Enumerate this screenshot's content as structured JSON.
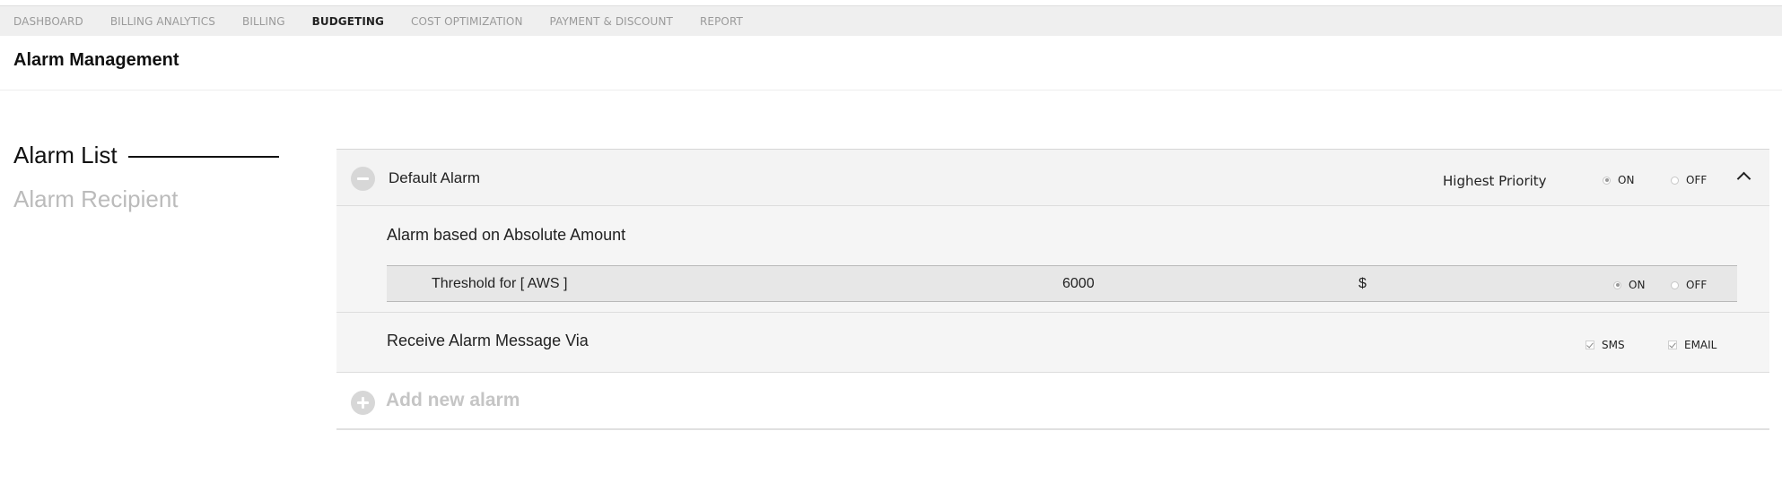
{
  "topnav": {
    "items": [
      {
        "label": "DASHBOARD",
        "active": false
      },
      {
        "label": "BILLING ANALYTICS",
        "active": false
      },
      {
        "label": "BILLING",
        "active": false
      },
      {
        "label": "BUDGETING",
        "active": true
      },
      {
        "label": "COST OPTIMIZATION",
        "active": false
      },
      {
        "label": "PAYMENT & DISCOUNT",
        "active": false
      },
      {
        "label": "REPORT",
        "active": false
      }
    ]
  },
  "page": {
    "title": "Alarm Management"
  },
  "sidenav": {
    "items": [
      {
        "label": "Alarm List",
        "active": true
      },
      {
        "label": "Alarm Recipient",
        "active": false
      }
    ]
  },
  "alarm": {
    "name": "Default Alarm",
    "priority_label": "Highest Priority",
    "priority_on": "ON",
    "priority_off": "OFF",
    "priority_selected": "ON",
    "section_title": "Alarm based on Absolute Amount",
    "threshold_label": "Threshold for [ AWS ]",
    "threshold_value": "6000",
    "currency": "$",
    "threshold_on": "ON",
    "threshold_off": "OFF",
    "threshold_selected": "ON",
    "receive_title": "Receive Alarm Message Via",
    "sms_label": "SMS",
    "sms_checked": true,
    "email_label": "EMAIL",
    "email_checked": true
  },
  "add_alarm": {
    "label": "Add new alarm"
  },
  "icons": {
    "collapse": "minus-circle-icon",
    "add": "plus-circle-icon",
    "chevron": "chevron-up-icon"
  }
}
